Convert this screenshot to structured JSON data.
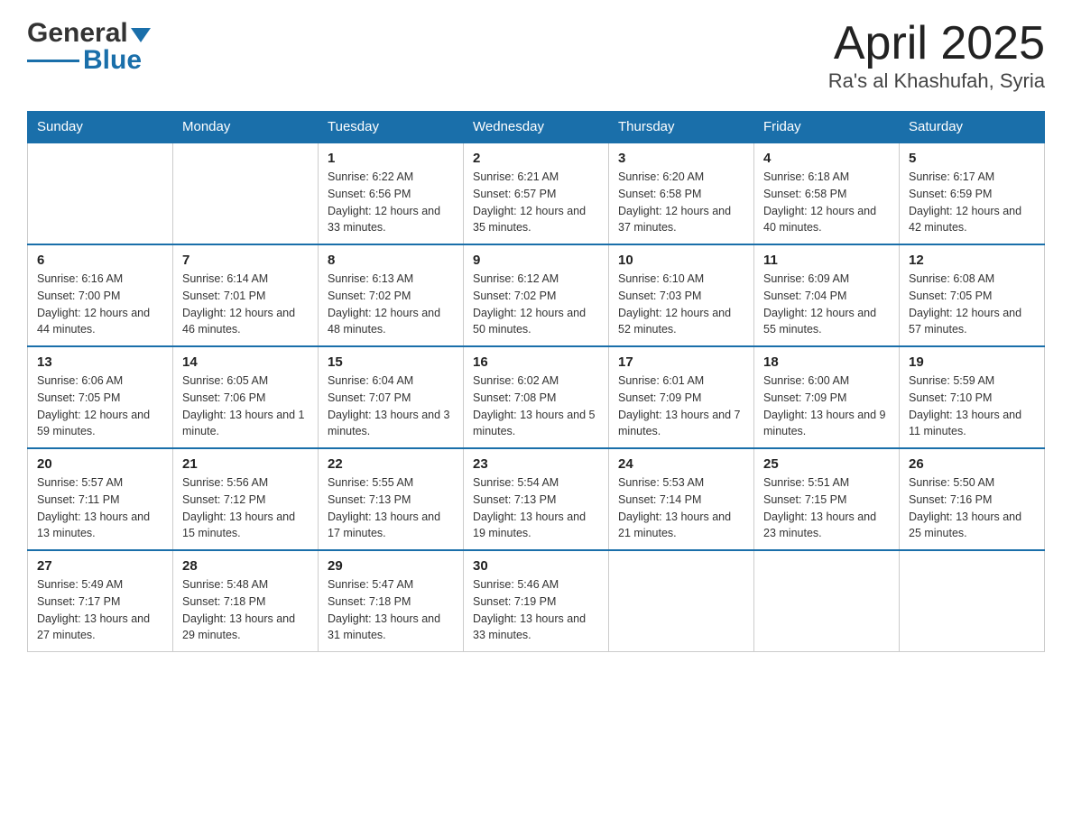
{
  "header": {
    "logo_text": "General Blue",
    "title": "April 2025",
    "subtitle": "Ra's al Khashufah, Syria"
  },
  "days_of_week": [
    "Sunday",
    "Monday",
    "Tuesday",
    "Wednesday",
    "Thursday",
    "Friday",
    "Saturday"
  ],
  "weeks": [
    [
      {
        "day": "",
        "sunrise": "",
        "sunset": "",
        "daylight": ""
      },
      {
        "day": "",
        "sunrise": "",
        "sunset": "",
        "daylight": ""
      },
      {
        "day": "1",
        "sunrise": "Sunrise: 6:22 AM",
        "sunset": "Sunset: 6:56 PM",
        "daylight": "Daylight: 12 hours and 33 minutes."
      },
      {
        "day": "2",
        "sunrise": "Sunrise: 6:21 AM",
        "sunset": "Sunset: 6:57 PM",
        "daylight": "Daylight: 12 hours and 35 minutes."
      },
      {
        "day": "3",
        "sunrise": "Sunrise: 6:20 AM",
        "sunset": "Sunset: 6:58 PM",
        "daylight": "Daylight: 12 hours and 37 minutes."
      },
      {
        "day": "4",
        "sunrise": "Sunrise: 6:18 AM",
        "sunset": "Sunset: 6:58 PM",
        "daylight": "Daylight: 12 hours and 40 minutes."
      },
      {
        "day": "5",
        "sunrise": "Sunrise: 6:17 AM",
        "sunset": "Sunset: 6:59 PM",
        "daylight": "Daylight: 12 hours and 42 minutes."
      }
    ],
    [
      {
        "day": "6",
        "sunrise": "Sunrise: 6:16 AM",
        "sunset": "Sunset: 7:00 PM",
        "daylight": "Daylight: 12 hours and 44 minutes."
      },
      {
        "day": "7",
        "sunrise": "Sunrise: 6:14 AM",
        "sunset": "Sunset: 7:01 PM",
        "daylight": "Daylight: 12 hours and 46 minutes."
      },
      {
        "day": "8",
        "sunrise": "Sunrise: 6:13 AM",
        "sunset": "Sunset: 7:02 PM",
        "daylight": "Daylight: 12 hours and 48 minutes."
      },
      {
        "day": "9",
        "sunrise": "Sunrise: 6:12 AM",
        "sunset": "Sunset: 7:02 PM",
        "daylight": "Daylight: 12 hours and 50 minutes."
      },
      {
        "day": "10",
        "sunrise": "Sunrise: 6:10 AM",
        "sunset": "Sunset: 7:03 PM",
        "daylight": "Daylight: 12 hours and 52 minutes."
      },
      {
        "day": "11",
        "sunrise": "Sunrise: 6:09 AM",
        "sunset": "Sunset: 7:04 PM",
        "daylight": "Daylight: 12 hours and 55 minutes."
      },
      {
        "day": "12",
        "sunrise": "Sunrise: 6:08 AM",
        "sunset": "Sunset: 7:05 PM",
        "daylight": "Daylight: 12 hours and 57 minutes."
      }
    ],
    [
      {
        "day": "13",
        "sunrise": "Sunrise: 6:06 AM",
        "sunset": "Sunset: 7:05 PM",
        "daylight": "Daylight: 12 hours and 59 minutes."
      },
      {
        "day": "14",
        "sunrise": "Sunrise: 6:05 AM",
        "sunset": "Sunset: 7:06 PM",
        "daylight": "Daylight: 13 hours and 1 minute."
      },
      {
        "day": "15",
        "sunrise": "Sunrise: 6:04 AM",
        "sunset": "Sunset: 7:07 PM",
        "daylight": "Daylight: 13 hours and 3 minutes."
      },
      {
        "day": "16",
        "sunrise": "Sunrise: 6:02 AM",
        "sunset": "Sunset: 7:08 PM",
        "daylight": "Daylight: 13 hours and 5 minutes."
      },
      {
        "day": "17",
        "sunrise": "Sunrise: 6:01 AM",
        "sunset": "Sunset: 7:09 PM",
        "daylight": "Daylight: 13 hours and 7 minutes."
      },
      {
        "day": "18",
        "sunrise": "Sunrise: 6:00 AM",
        "sunset": "Sunset: 7:09 PM",
        "daylight": "Daylight: 13 hours and 9 minutes."
      },
      {
        "day": "19",
        "sunrise": "Sunrise: 5:59 AM",
        "sunset": "Sunset: 7:10 PM",
        "daylight": "Daylight: 13 hours and 11 minutes."
      }
    ],
    [
      {
        "day": "20",
        "sunrise": "Sunrise: 5:57 AM",
        "sunset": "Sunset: 7:11 PM",
        "daylight": "Daylight: 13 hours and 13 minutes."
      },
      {
        "day": "21",
        "sunrise": "Sunrise: 5:56 AM",
        "sunset": "Sunset: 7:12 PM",
        "daylight": "Daylight: 13 hours and 15 minutes."
      },
      {
        "day": "22",
        "sunrise": "Sunrise: 5:55 AM",
        "sunset": "Sunset: 7:13 PM",
        "daylight": "Daylight: 13 hours and 17 minutes."
      },
      {
        "day": "23",
        "sunrise": "Sunrise: 5:54 AM",
        "sunset": "Sunset: 7:13 PM",
        "daylight": "Daylight: 13 hours and 19 minutes."
      },
      {
        "day": "24",
        "sunrise": "Sunrise: 5:53 AM",
        "sunset": "Sunset: 7:14 PM",
        "daylight": "Daylight: 13 hours and 21 minutes."
      },
      {
        "day": "25",
        "sunrise": "Sunrise: 5:51 AM",
        "sunset": "Sunset: 7:15 PM",
        "daylight": "Daylight: 13 hours and 23 minutes."
      },
      {
        "day": "26",
        "sunrise": "Sunrise: 5:50 AM",
        "sunset": "Sunset: 7:16 PM",
        "daylight": "Daylight: 13 hours and 25 minutes."
      }
    ],
    [
      {
        "day": "27",
        "sunrise": "Sunrise: 5:49 AM",
        "sunset": "Sunset: 7:17 PM",
        "daylight": "Daylight: 13 hours and 27 minutes."
      },
      {
        "day": "28",
        "sunrise": "Sunrise: 5:48 AM",
        "sunset": "Sunset: 7:18 PM",
        "daylight": "Daylight: 13 hours and 29 minutes."
      },
      {
        "day": "29",
        "sunrise": "Sunrise: 5:47 AM",
        "sunset": "Sunset: 7:18 PM",
        "daylight": "Daylight: 13 hours and 31 minutes."
      },
      {
        "day": "30",
        "sunrise": "Sunrise: 5:46 AM",
        "sunset": "Sunset: 7:19 PM",
        "daylight": "Daylight: 13 hours and 33 minutes."
      },
      {
        "day": "",
        "sunrise": "",
        "sunset": "",
        "daylight": ""
      },
      {
        "day": "",
        "sunrise": "",
        "sunset": "",
        "daylight": ""
      },
      {
        "day": "",
        "sunrise": "",
        "sunset": "",
        "daylight": ""
      }
    ]
  ]
}
